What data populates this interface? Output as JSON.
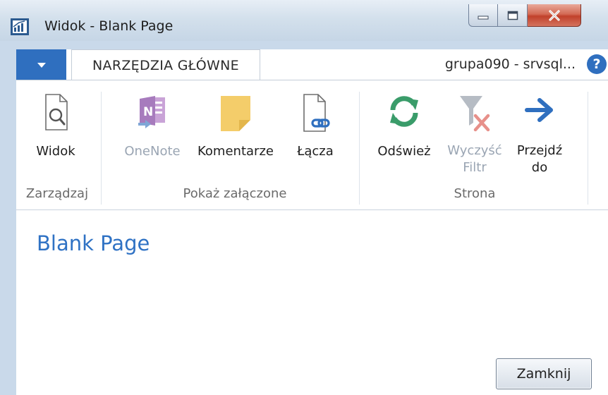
{
  "window": {
    "title": "Widok - Blank Page",
    "caption_buttons": [
      "minimize",
      "maximize",
      "close"
    ]
  },
  "ribbon": {
    "menu_icon": "chevron-down-icon",
    "active_tab": "NARZĘDZIA GŁÓWNE",
    "connection_text": "grupa090 - srvsql...",
    "help_glyph": "?",
    "groups": [
      {
        "label": "Zarządzaj",
        "buttons": [
          {
            "label": "Widok",
            "icon": "page-magnifier-icon",
            "enabled": true
          }
        ]
      },
      {
        "label": "Pokaż załączone",
        "buttons": [
          {
            "label": "OneNote",
            "icon": "onenote-icon",
            "enabled": false
          },
          {
            "label": "Komentarze",
            "icon": "note-icon",
            "enabled": true
          },
          {
            "label": "Łącza",
            "icon": "page-link-icon",
            "enabled": true
          }
        ]
      },
      {
        "label": "Strona",
        "buttons": [
          {
            "label": "Odśwież",
            "icon": "refresh-icon",
            "enabled": true
          },
          {
            "label_line1": "Wyczyść",
            "label_line2": "Filtr",
            "icon": "clear-filter-icon",
            "enabled": false
          },
          {
            "label_line1": "Przejdź",
            "label_line2": "do",
            "icon": "arrow-right-icon",
            "enabled": true
          }
        ]
      }
    ]
  },
  "content": {
    "page_title": "Blank Page",
    "close_button": "Zamknij"
  },
  "colors": {
    "accent": "#2f6fbf",
    "title_blue": "#2f72c4",
    "refresh_green": "#3a9c6a",
    "note_yellow": "#f4cd6a",
    "onenote_purple": "#9b58b5",
    "close_red": "#c1412b"
  }
}
